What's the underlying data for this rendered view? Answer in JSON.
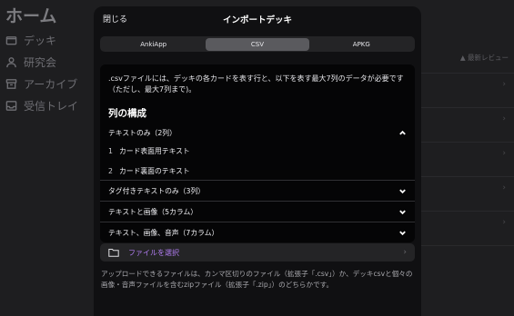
{
  "background": {
    "title": "ホーム",
    "sidebar": [
      {
        "icon": "folder-icon",
        "label": "デッキ"
      },
      {
        "icon": "people-icon",
        "label": "研究会"
      },
      {
        "icon": "archive-icon",
        "label": "アーカイブ"
      },
      {
        "icon": "inbox-icon",
        "label": "受信トレイ"
      }
    ],
    "right_label": "▲ 最新レビュー"
  },
  "modal": {
    "close_label": "閉じる",
    "title": "インポートデッキ",
    "tabs": [
      "AnkiApp",
      "CSV",
      "APKG"
    ],
    "active_tab": "CSV",
    "description": ".csvファイルには、デッキの各カードを表す行と、以下を表す最大7列のデータが必要です（ただし、最大7列まで)。",
    "columns_heading": "列の構成",
    "sections": [
      {
        "label": "テキストのみ（2列）",
        "expanded": true,
        "items": [
          {
            "num": "1",
            "text": "カード表面用テキスト"
          },
          {
            "num": "2",
            "text": "カード裏面のテキスト"
          }
        ]
      },
      {
        "label": "タグ付きテキストのみ（3列）",
        "expanded": false
      },
      {
        "label": "テキストと画像（5カラム）",
        "expanded": false
      },
      {
        "label": "テキスト、画像、音声（7カラム）",
        "expanded": false
      }
    ],
    "file_button_label": "ファイルを選択",
    "footer_note": "アップロードできるファイルは、カンマ区切りのファイル（拡張子「.csv」）か、デッキcsvと個々の画像・音声ファイルを含むzipファイル（拡張子「.zip」）のどちらかです。"
  }
}
